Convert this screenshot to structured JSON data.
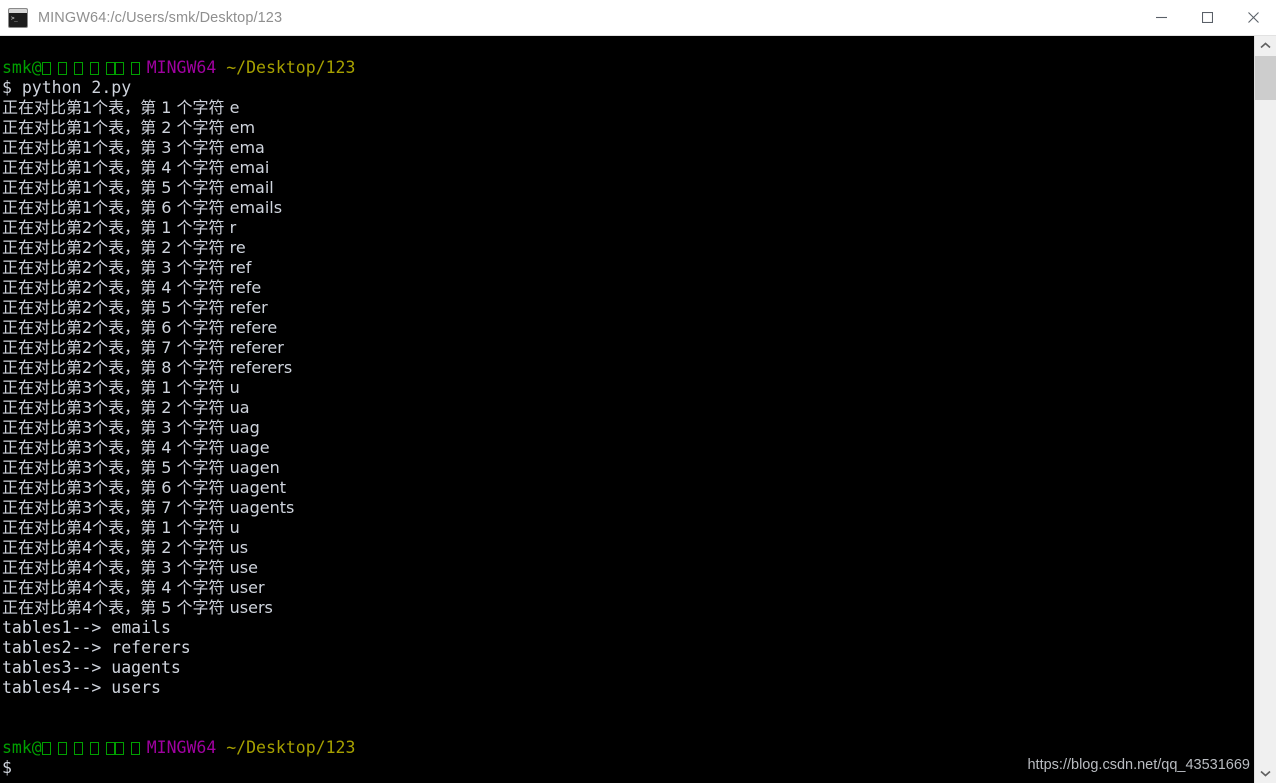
{
  "window": {
    "title": "MINGW64:/c/Users/smk/Desktop/123",
    "icon": "console-icon",
    "controls": {
      "minimize": "minimize-icon",
      "maximize": "maximize-icon",
      "close": "close-icon"
    }
  },
  "terminal": {
    "background": "#000000",
    "foreground": "#cfd4dd",
    "colors": {
      "user": "#00a000",
      "shell": "#a000a0",
      "path": "#a6a000",
      "text": "#cfd4dd"
    },
    "prompt": {
      "user": "smk@",
      "host_tofu_count": 8,
      "shell": "MINGW64",
      "path": "~/Desktop/123",
      "sigil": "$"
    },
    "command": "$ python 2.py",
    "lines": [
      "正在对比第1个表，第 1 个字符 e",
      "正在对比第1个表，第 2 个字符 em",
      "正在对比第1个表，第 3 个字符 ema",
      "正在对比第1个表，第 4 个字符 emai",
      "正在对比第1个表，第 5 个字符 email",
      "正在对比第1个表，第 6 个字符 emails",
      "正在对比第2个表，第 1 个字符 r",
      "正在对比第2个表，第 2 个字符 re",
      "正在对比第2个表，第 3 个字符 ref",
      "正在对比第2个表，第 4 个字符 refe",
      "正在对比第2个表，第 5 个字符 refer",
      "正在对比第2个表，第 6 个字符 refere",
      "正在对比第2个表，第 7 个字符 referer",
      "正在对比第2个表，第 8 个字符 referers",
      "正在对比第3个表，第 1 个字符 u",
      "正在对比第3个表，第 2 个字符 ua",
      "正在对比第3个表，第 3 个字符 uag",
      "正在对比第3个表，第 4 个字符 uage",
      "正在对比第3个表，第 5 个字符 uagen",
      "正在对比第3个表，第 6 个字符 uagent",
      "正在对比第3个表，第 7 个字符 uagents",
      "正在对比第4个表，第 1 个字符 u",
      "正在对比第4个表，第 2 个字符 us",
      "正在对比第4个表，第 3 个字符 use",
      "正在对比第4个表，第 4 个字符 user",
      "正在对比第4个表，第 5 个字符 users",
      "tables1--> emails",
      "tables2--> referers",
      "tables3--> uagents",
      "tables4--> users"
    ]
  },
  "scrollbar": {
    "up_arrow": "chevron-up-icon",
    "down_arrow": "chevron-down-icon",
    "thumb_position": "top"
  },
  "watermark": {
    "text": "https://blog.csdn.net/qq_43531669"
  }
}
